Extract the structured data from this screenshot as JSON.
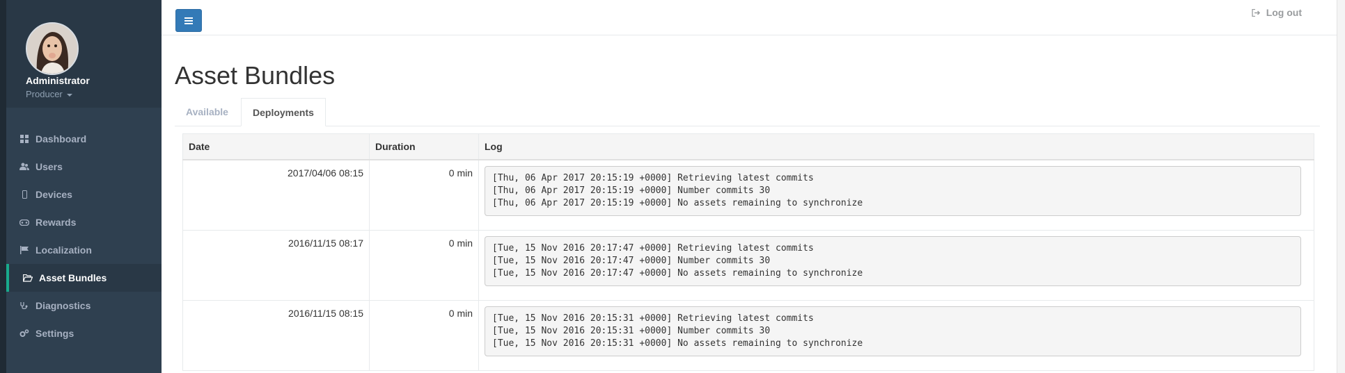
{
  "profile": {
    "name": "Administrator",
    "role": "Producer"
  },
  "sidebar": {
    "items": [
      {
        "label": "Dashboard",
        "icon": "dashboard-icon"
      },
      {
        "label": "Users",
        "icon": "users-icon"
      },
      {
        "label": "Devices",
        "icon": "mobile-icon"
      },
      {
        "label": "Rewards",
        "icon": "gamepad-icon"
      },
      {
        "label": "Localization",
        "icon": "flag-icon"
      },
      {
        "label": "Asset Bundles",
        "icon": "folder-open-icon",
        "active": true
      },
      {
        "label": "Diagnostics",
        "icon": "stethoscope-icon"
      },
      {
        "label": "Settings",
        "icon": "cogs-icon"
      }
    ]
  },
  "topbar": {
    "logout_label": "Log out"
  },
  "page": {
    "title": "Asset Bundles"
  },
  "tabs": [
    {
      "label": "Available",
      "active": false
    },
    {
      "label": "Deployments",
      "active": true
    }
  ],
  "table": {
    "headers": [
      "Date",
      "Duration",
      "Log"
    ],
    "rows": [
      {
        "date": "2017/04/06 08:15",
        "duration": "0 min",
        "log": [
          "[Thu, 06 Apr 2017 20:15:19 +0000] Retrieving latest commits",
          "[Thu, 06 Apr 2017 20:15:19 +0000] Number commits 30",
          "[Thu, 06 Apr 2017 20:15:19 +0000] No assets remaining to synchronize"
        ]
      },
      {
        "date": "2016/11/15 08:17",
        "duration": "0 min",
        "log": [
          "[Tue, 15 Nov 2016 20:17:47 +0000] Retrieving latest commits",
          "[Tue, 15 Nov 2016 20:17:47 +0000] Number commits 30",
          "[Tue, 15 Nov 2016 20:17:47 +0000] No assets remaining to synchronize"
        ]
      },
      {
        "date": "2016/11/15 08:15",
        "duration": "0 min",
        "log": [
          "[Tue, 15 Nov 2016 20:15:31 +0000] Retrieving latest commits",
          "[Tue, 15 Nov 2016 20:15:31 +0000] Number commits 30",
          "[Tue, 15 Nov 2016 20:15:31 +0000] No assets remaining to synchronize"
        ]
      }
    ]
  }
}
